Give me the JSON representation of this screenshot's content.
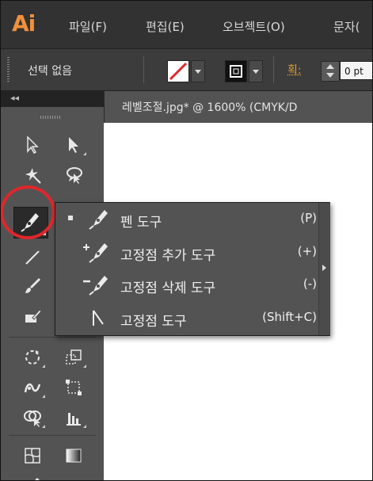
{
  "app": {
    "logo": "Ai",
    "logo_color": "#f2903a"
  },
  "menu": [
    {
      "label": "파일(F)"
    },
    {
      "label": "편집(E)"
    },
    {
      "label": "오브젝트(O)"
    },
    {
      "label": "문자("
    }
  ],
  "control_bar": {
    "selection_text": "선택 없음",
    "stroke_label": "획:",
    "stroke_value": "0 pt"
  },
  "tools_panel": {
    "collapse_glyph": "◂◂"
  },
  "document": {
    "tab_title": "레벨조절.jpg* @ 1600% (CMYK/D"
  },
  "pen_flyout": {
    "items": [
      {
        "label": "펜 도구",
        "shortcut": "(P)",
        "icon": "pen-icon",
        "selected": true
      },
      {
        "label": "고정점 추가 도구",
        "shortcut": "(+)",
        "icon": "add-anchor-point-icon",
        "selected": false
      },
      {
        "label": "고정점 삭제 도구",
        "shortcut": "(-)",
        "icon": "delete-anchor-point-icon",
        "selected": false
      },
      {
        "label": "고정점 도구",
        "shortcut": "(Shift+C)",
        "icon": "anchor-point-icon",
        "selected": false
      }
    ]
  },
  "colors": {
    "accent": "#f2903a",
    "highlight_ring": "#e0262b",
    "panel": "#535353",
    "stroke_label": "#e0a030"
  }
}
